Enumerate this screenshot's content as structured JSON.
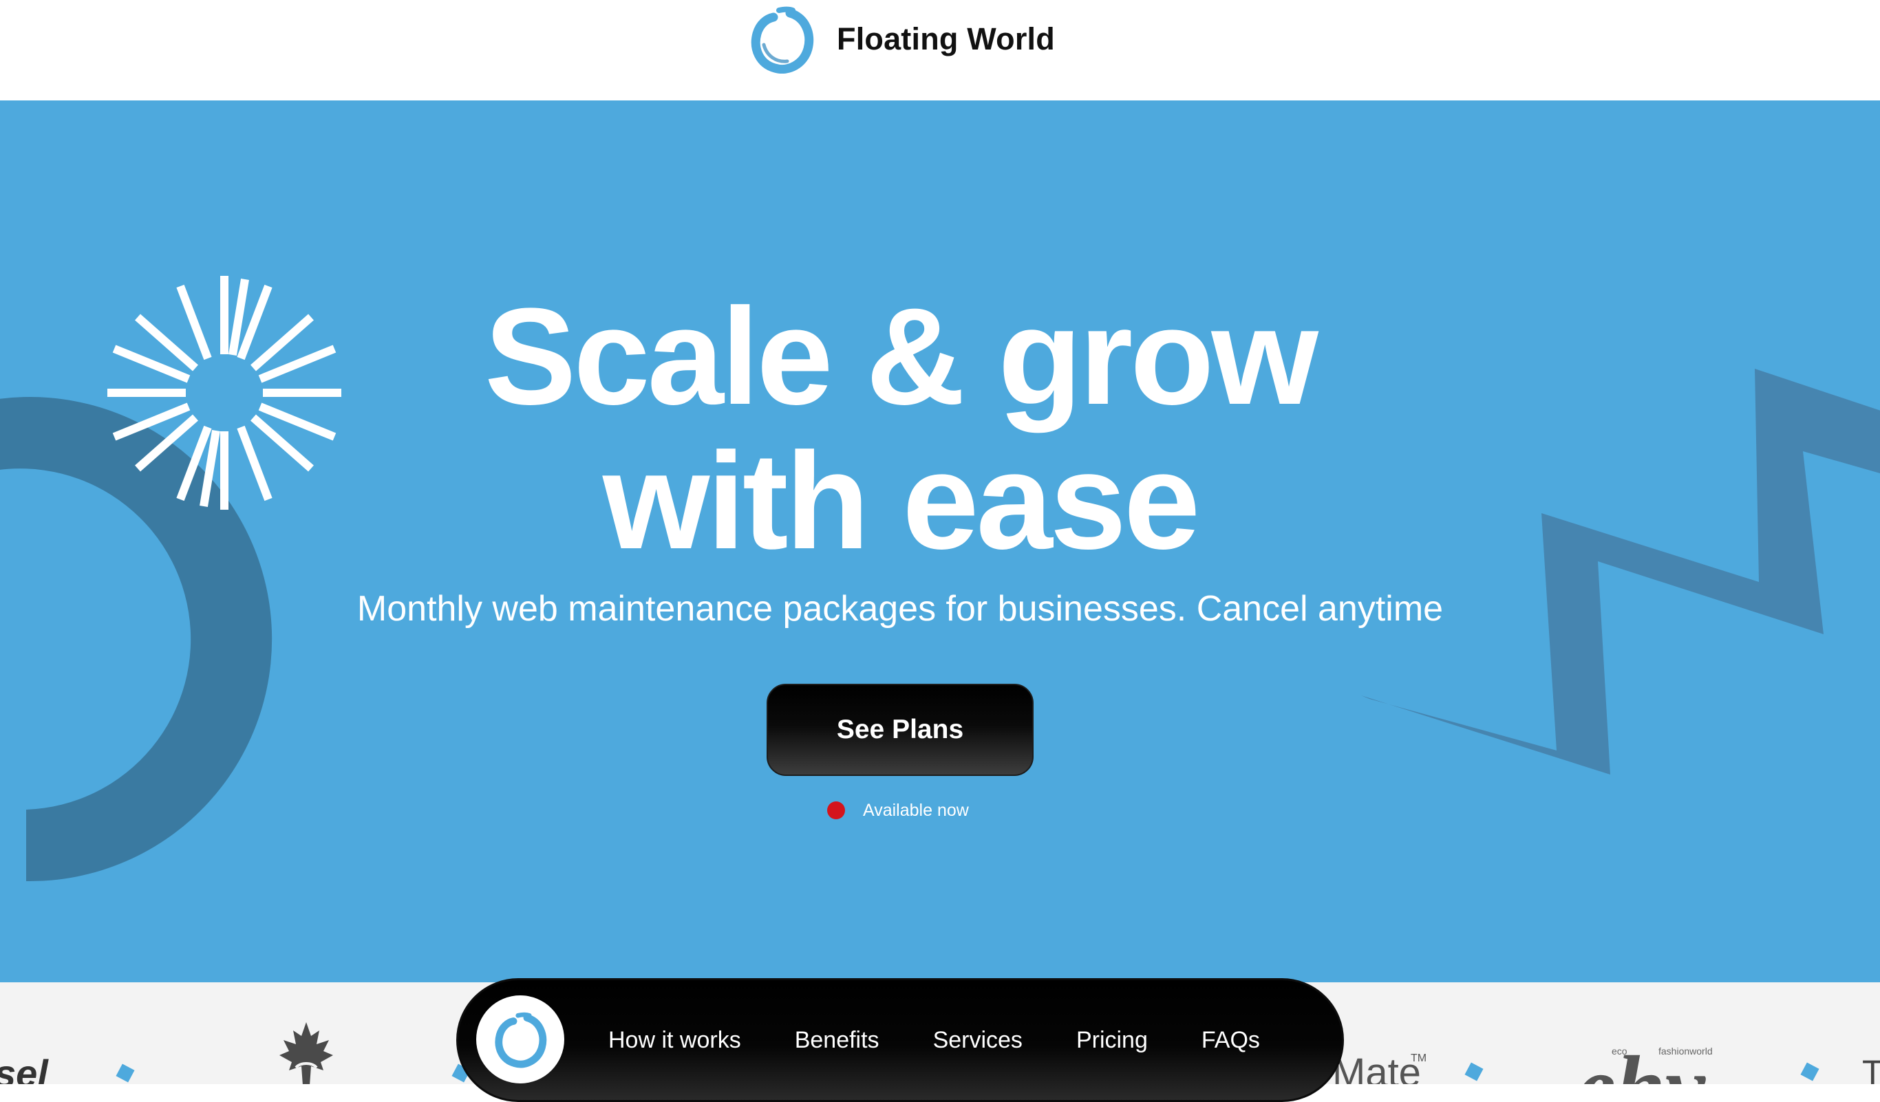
{
  "header": {
    "brand_name": "Floating World",
    "logo_icon": "enso-circle-icon"
  },
  "hero": {
    "title_line1": "Scale & grow",
    "title_line2": "with ease",
    "subtitle": "Monthly web maintenance packages for businesses. Cancel anytime",
    "cta_label": "See Plans",
    "availability_text": "Available now",
    "status_color": "#d4141c",
    "background_color": "#4ea9dd"
  },
  "clients": {
    "partial_1": "sel",
    "partial_mate": "Mate",
    "partial_mate_tm": "TM",
    "ehv_text": "ehv",
    "ehv_small_1": "eco",
    "ehv_small_2": "fashionworld",
    "partial_t": "T"
  },
  "nav": {
    "logo_icon": "enso-circle-icon",
    "items": [
      {
        "label": "How it works"
      },
      {
        "label": "Benefits"
      },
      {
        "label": "Services"
      },
      {
        "label": "Pricing"
      },
      {
        "label": "FAQs"
      }
    ]
  },
  "colors": {
    "accent": "#4ea9dd",
    "dark_shape": "#3a7aa1",
    "nav_bg": "#000000",
    "text_light": "#ffffff"
  }
}
